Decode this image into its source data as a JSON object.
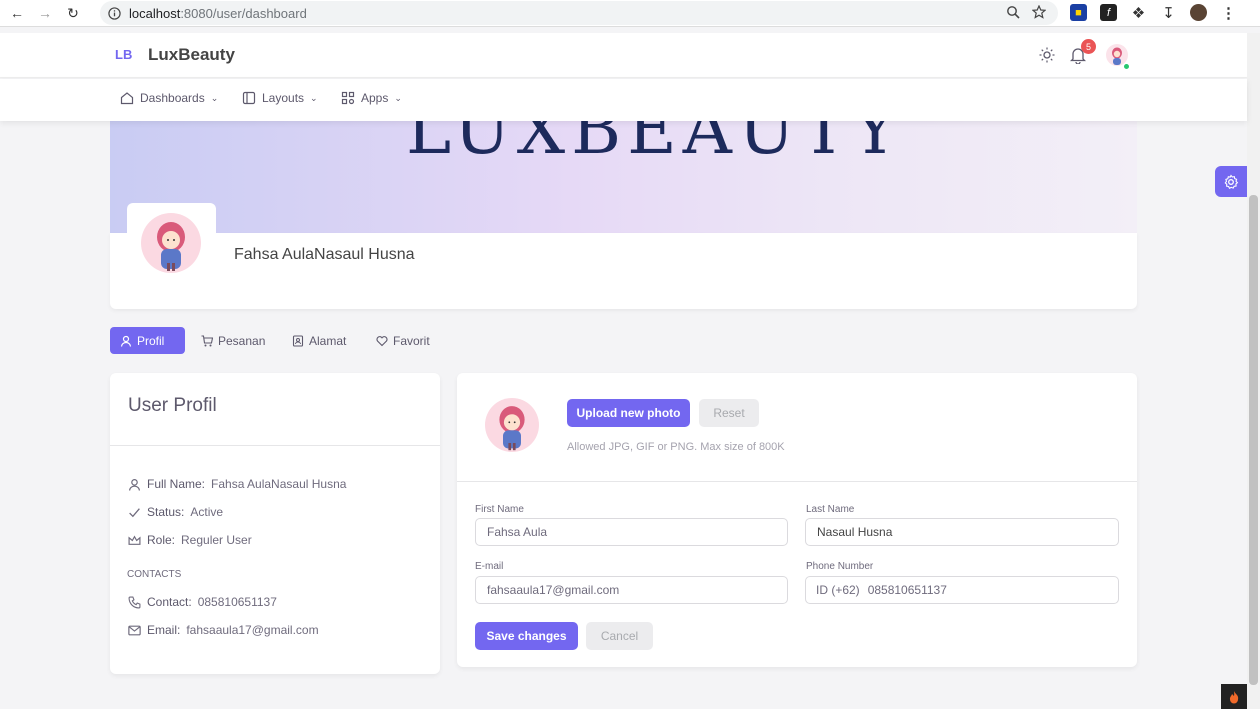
{
  "browser": {
    "url_host": "localhost",
    "url_path": ":8080/user/dashboard"
  },
  "app": {
    "logo_mark": "LB",
    "logo_text": "LuxBeauty",
    "notification_count": "5"
  },
  "menu": [
    {
      "label": "Dashboards"
    },
    {
      "label": "Layouts"
    },
    {
      "label": "Apps"
    }
  ],
  "banner": {
    "text": "LUXBEAUTY"
  },
  "profile": {
    "name": "Fahsa AulaNasaul Husna"
  },
  "tabs": [
    {
      "label": "Profil"
    },
    {
      "label": "Pesanan"
    },
    {
      "label": "Alamat"
    },
    {
      "label": "Favorit"
    }
  ],
  "user_card": {
    "title": "User Profil",
    "full_name_label": "Full Name:",
    "full_name": "Fahsa AulaNasaul Husna",
    "status_label": "Status:",
    "status": "Active",
    "role_label": "Role:",
    "role": "Reguler User",
    "contacts_heading": "CONTACTS",
    "contact_label": "Contact:",
    "contact": "085810651137",
    "email_label": "Email:",
    "email": "fahsaaula17@gmail.com"
  },
  "photo": {
    "upload_label": "Upload new photo",
    "reset_label": "Reset",
    "hint": "Allowed JPG, GIF or PNG. Max size of 800K"
  },
  "form": {
    "first_name_label": "First Name",
    "first_name": "Fahsa Aula",
    "last_name_label": "Last Name",
    "last_name": "Nasaul Husna",
    "email_label": "E-mail",
    "email": "fahsaaula17@gmail.com",
    "phone_label": "Phone Number",
    "phone_prefix": "ID (+62)",
    "phone": "085810651137",
    "save_label": "Save changes",
    "cancel_label": "Cancel"
  },
  "colors": {
    "primary": "#7367f0",
    "badge": "#ea5455"
  }
}
